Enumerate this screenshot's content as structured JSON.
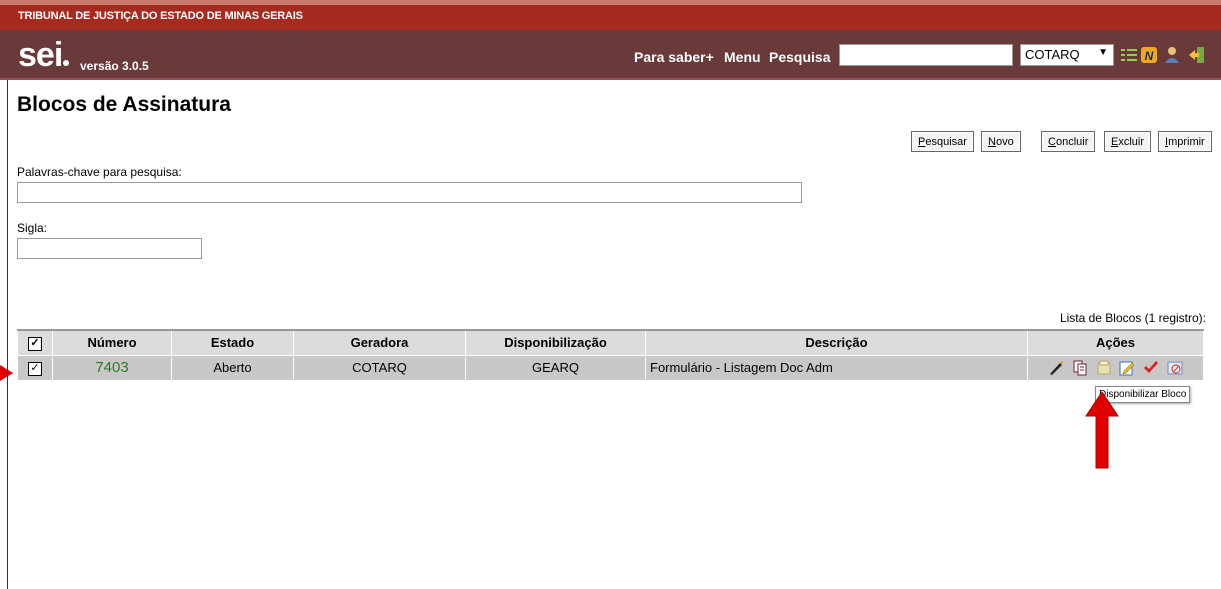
{
  "header": {
    "org_name": "TRIBUNAL DE JUSTIÇA DO ESTADO DE MINAS GERAIS",
    "logo": "sei",
    "version": "versão 3.0.5",
    "nav": [
      "Para saber+",
      "Menu",
      "Pesquisa"
    ],
    "search_value": "",
    "unit": "COTARQ",
    "icons": [
      "list-icon",
      "notes-icon",
      "user-icon",
      "exit-icon"
    ]
  },
  "page": {
    "title": "Blocos de Assinatura",
    "buttons": [
      {
        "first": "P",
        "rest": "esquisar"
      },
      {
        "first": "N",
        "rest": "ovo"
      },
      {
        "first": "C",
        "rest": "oncluir"
      },
      {
        "first": "E",
        "rest": "xcluir"
      },
      {
        "first": "I",
        "rest": "mprimir"
      }
    ],
    "keywords_label": "Palavras-chave para pesquisa:",
    "keywords_value": "",
    "sigla_label": "Sigla:",
    "sigla_value": ""
  },
  "table": {
    "caption": "Lista de Blocos (1 registro):",
    "headers": [
      "Número",
      "Estado",
      "Geradora",
      "Disponibilização",
      "Descrição",
      "Ações"
    ],
    "rows": [
      {
        "numero": "7403",
        "estado": "Aberto",
        "geradora": "COTARQ",
        "disponibilizacao": "GEARQ",
        "descricao": "Formulário - Listagem Doc Adm",
        "checked": true
      }
    ],
    "actions": [
      "sign-icon",
      "documents-icon",
      "make-available-icon",
      "edit-icon",
      "conclude-icon",
      "cancel-availability-icon"
    ]
  },
  "tooltip": "Disponibilizar Bloco",
  "colors": {
    "org_bar": "#a52a1f",
    "main_bar": "#6a3a3a",
    "accent_green": "#2a7a2a",
    "arrow_red": "#e00000"
  }
}
